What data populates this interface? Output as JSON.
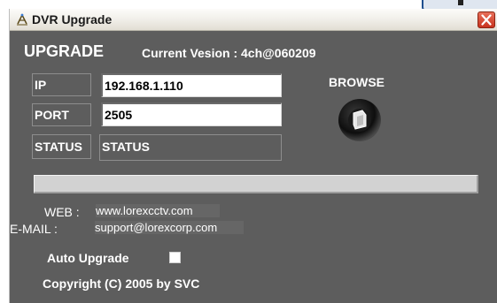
{
  "window": {
    "title": "DVR Upgrade",
    "close_glyph": "close-icon",
    "background_color": "#5d5d5d"
  },
  "header": {
    "heading": "UPGRADE",
    "version_text": "Current Vesion : 4ch@060209"
  },
  "form": {
    "ip_label": "IP",
    "ip_value": "192.168.1.110",
    "port_label": "PORT",
    "port_value": "2505",
    "status_label": "STATUS",
    "status_value": "STATUS"
  },
  "browse": {
    "label": "BROWSE",
    "icon": "folder-open-icon"
  },
  "progress": {
    "fraction": 0
  },
  "contact": {
    "web_label": "WEB :",
    "web_value": "www.lorexcctv.com",
    "email_label": "E-MAIL :",
    "email_value": "support@lorexcorp.com"
  },
  "auto_upgrade": {
    "label": "Auto Upgrade",
    "checked": false
  },
  "footer": {
    "copyright": "Copyright (C) 2005 by SVC"
  }
}
